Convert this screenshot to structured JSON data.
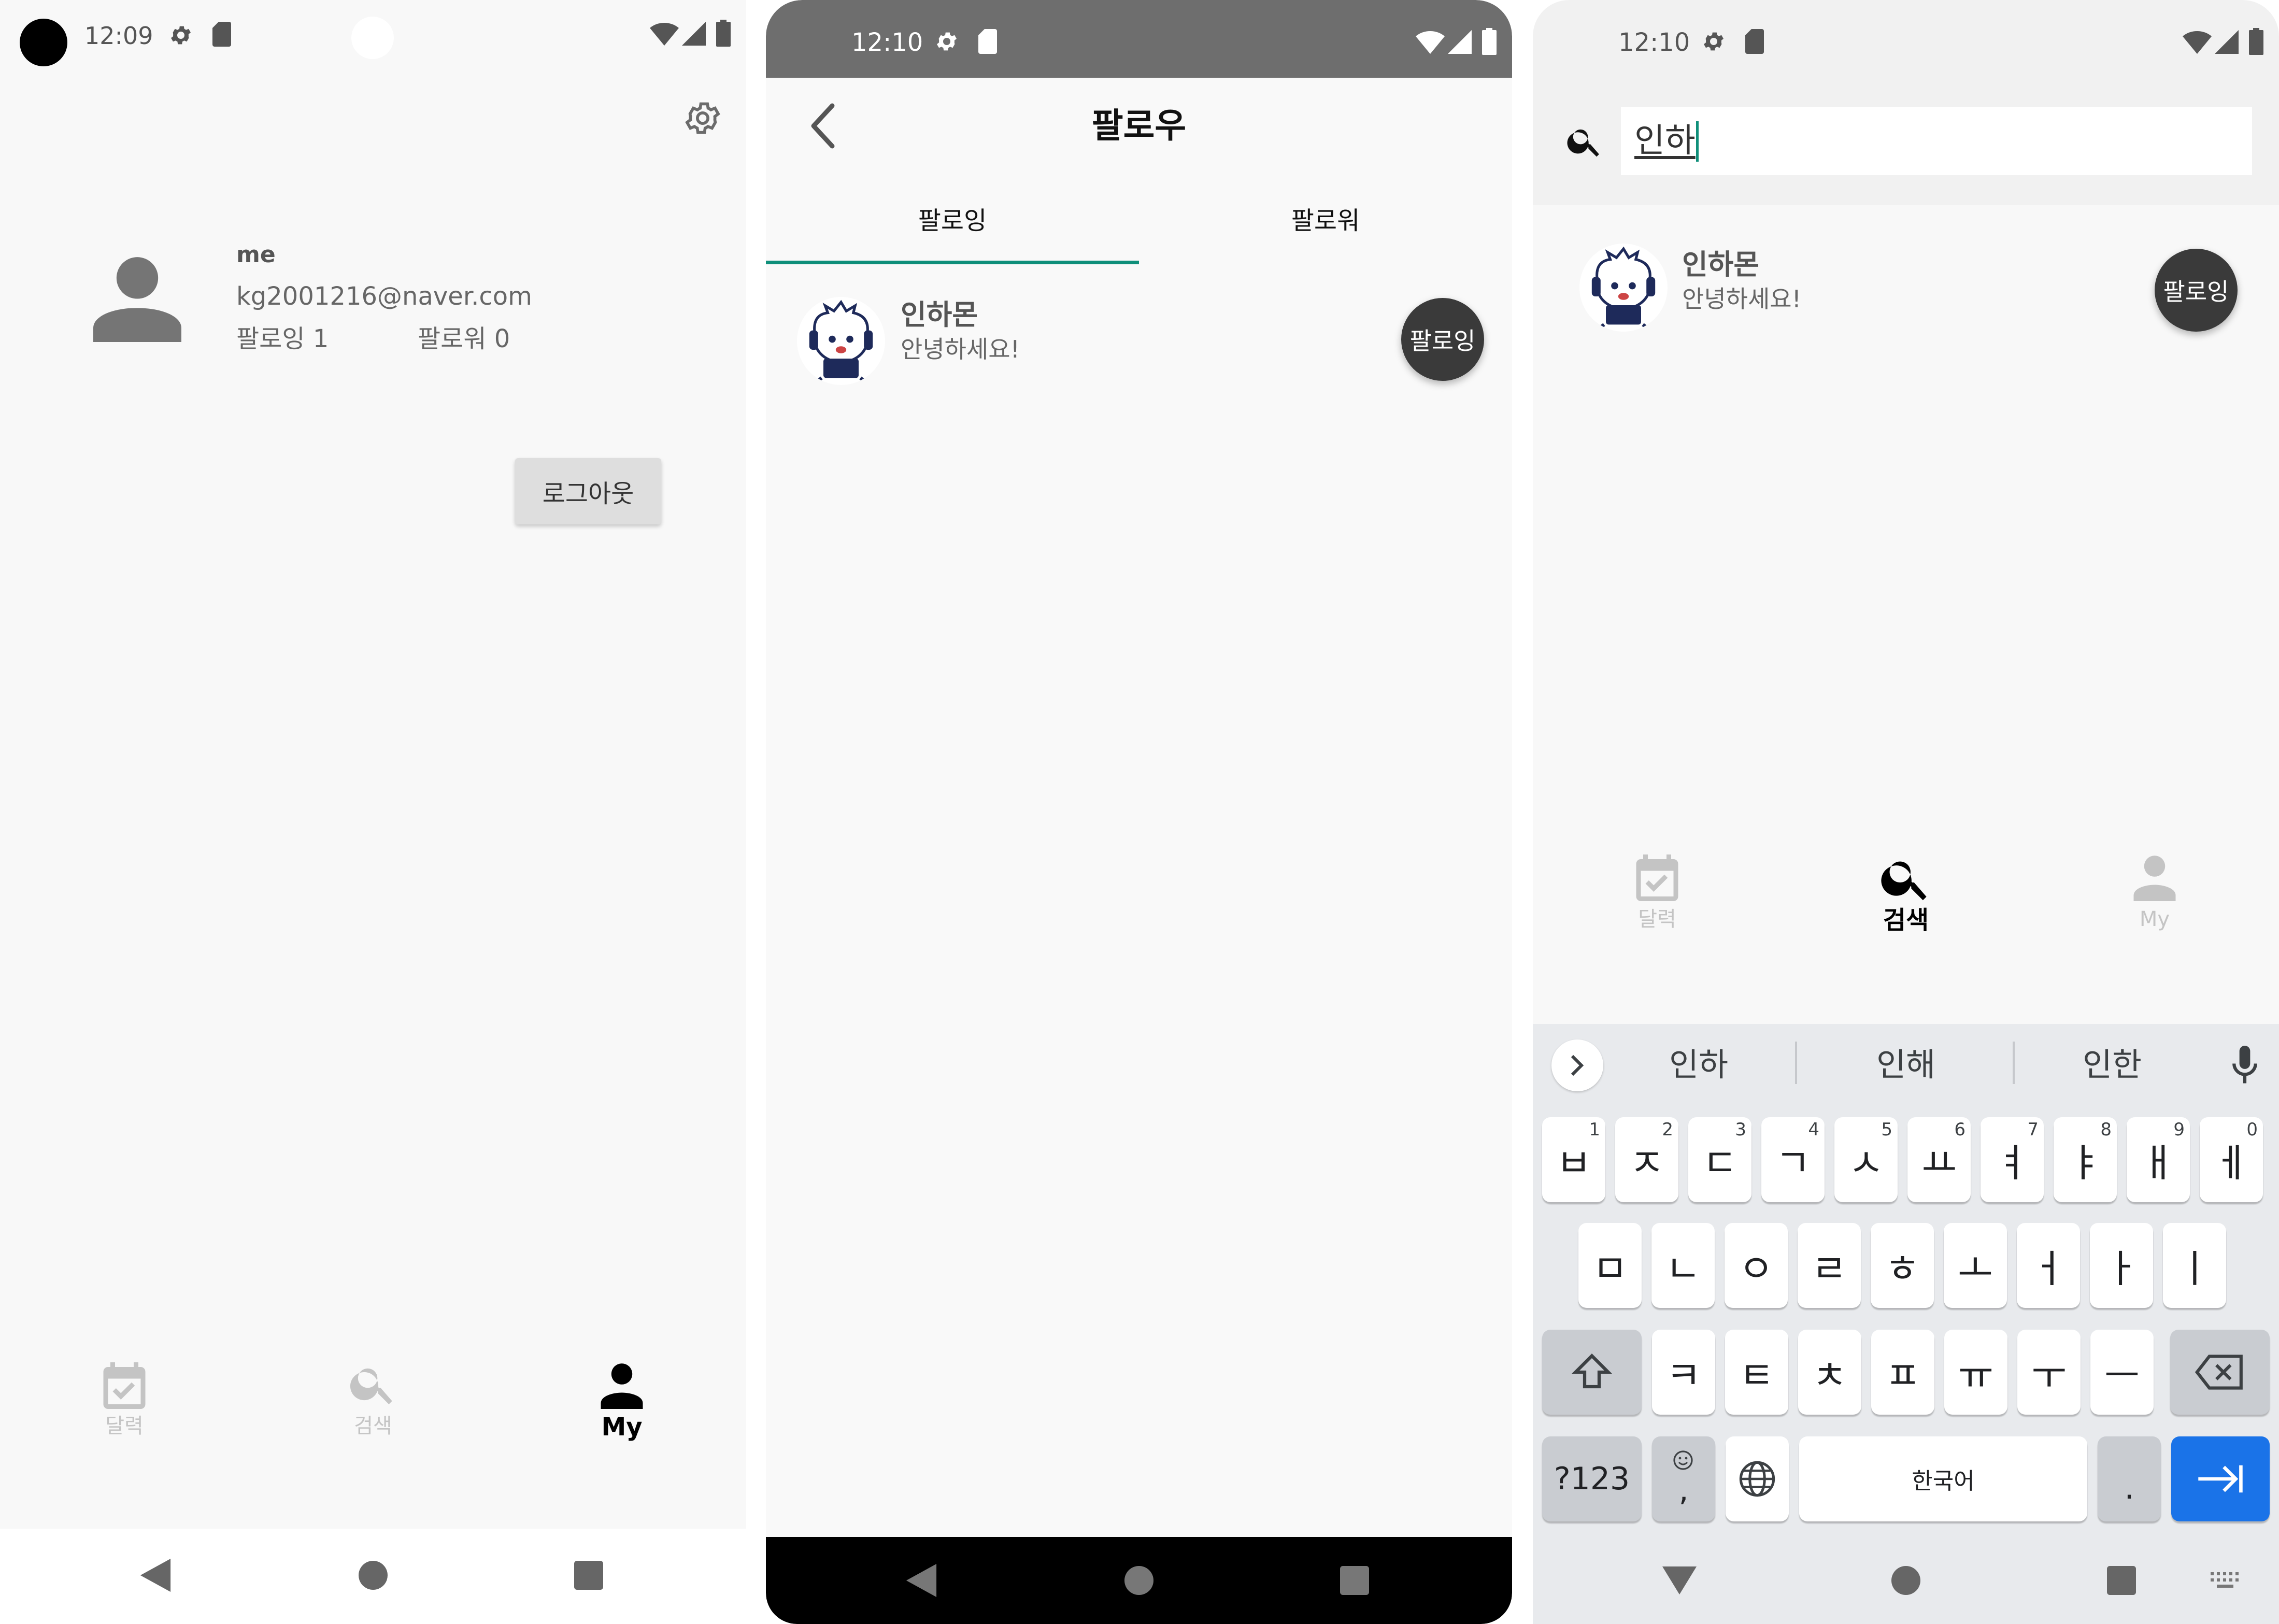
{
  "screens": {
    "my": {
      "status_time": "12:09",
      "profile": {
        "name": "me",
        "email": "kg2001216@naver.com",
        "following_label": "팔로잉 1",
        "followers_label": "팔로워 0"
      },
      "logout_button": "로그아웃",
      "nav": {
        "calendar": "달력",
        "search": "검색",
        "my": "My"
      },
      "active_tab": "my"
    },
    "follow": {
      "status_time": "12:10",
      "title": "팔로우",
      "tabs": [
        "팔로잉",
        "팔로워"
      ],
      "active_tab": "팔로잉",
      "users": [
        {
          "name": "인하몬",
          "bio": "안녕하세요!",
          "button": "팔로잉"
        }
      ]
    },
    "search": {
      "status_time": "12:10",
      "search_value": "인하",
      "results": [
        {
          "name": "인하몬",
          "bio": "안녕하세요!",
          "button": "팔로잉"
        }
      ],
      "nav": {
        "calendar": "달력",
        "search": "검색",
        "my": "My"
      },
      "active_tab": "search",
      "keyboard": {
        "suggestions": [
          "인하",
          "인해",
          "인한"
        ],
        "row1": [
          {
            "k": "ㅂ",
            "n": "1"
          },
          {
            "k": "ㅈ",
            "n": "2"
          },
          {
            "k": "ㄷ",
            "n": "3"
          },
          {
            "k": "ㄱ",
            "n": "4"
          },
          {
            "k": "ㅅ",
            "n": "5"
          },
          {
            "k": "ㅛ",
            "n": "6"
          },
          {
            "k": "ㅕ",
            "n": "7"
          },
          {
            "k": "ㅑ",
            "n": "8"
          },
          {
            "k": "ㅐ",
            "n": "9"
          },
          {
            "k": "ㅔ",
            "n": "0"
          }
        ],
        "row2": [
          "ㅁ",
          "ㄴ",
          "ㅇ",
          "ㄹ",
          "ㅎ",
          "ㅗ",
          "ㅓ",
          "ㅏ",
          "ㅣ"
        ],
        "row3": [
          "ㅋ",
          "ㅌ",
          "ㅊ",
          "ㅍ",
          "ㅠ",
          "ㅜ",
          "ㅡ"
        ],
        "symbols_key": "?123",
        "emoji_comma": ",",
        "space_label": "한국어",
        "period": "."
      }
    }
  },
  "colors": {
    "accent_teal": "#0f8f7a",
    "enter_blue": "#1a73e8",
    "inactive_gray": "#c4c4c4",
    "status_bar_gray": "#6b6b6b"
  }
}
